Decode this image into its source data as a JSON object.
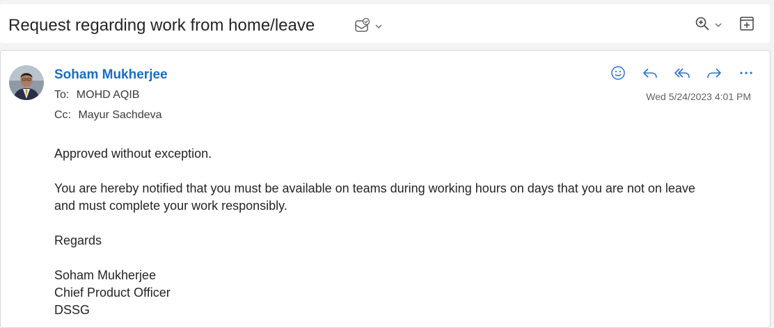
{
  "subject": "Request regarding work from home/leave",
  "message": {
    "sender_name": "Soham Mukherjee",
    "to_label": "To:",
    "to_value": "MOHD AQIB",
    "cc_label": "Cc:",
    "cc_value": "Mayur Sachdeva",
    "date": "Wed 5/24/2023 4:01 PM",
    "body": {
      "line1": "Approved without exception.",
      "line2a": "You are hereby notified that you must be available on teams during working hours on days that you are not on leave",
      "line2b": "and must complete your work responsibly.",
      "line3": "Regards",
      "sig_name": "Soham Mukherjee",
      "sig_title": "Chief Product Officer",
      "sig_company": "DSSG"
    }
  },
  "icons": {
    "subject_mark": "envelope-check-icon",
    "zoom": "zoom-in-icon",
    "popout": "open-in-new-window-icon",
    "emoji": "emoji-reaction-icon",
    "reply": "reply-icon",
    "reply_all": "reply-all-icon",
    "forward": "forward-icon",
    "more": "more-actions-icon"
  },
  "colors": {
    "accent": "#1b6cc0",
    "icon_blue": "#2a71d0",
    "text": "#242424",
    "muted": "#616161"
  }
}
